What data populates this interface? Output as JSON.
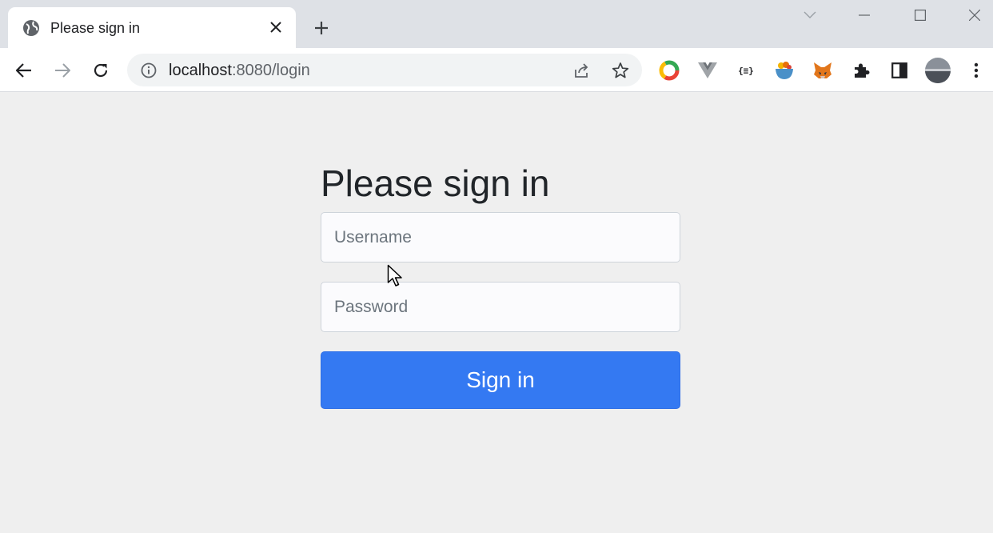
{
  "browser": {
    "tab_title": "Please sign in",
    "url_host": "localhost",
    "url_path": ":8080/login"
  },
  "page": {
    "heading": "Please sign in",
    "username_placeholder": "Username",
    "password_placeholder": "Password",
    "signin_label": "Sign in"
  },
  "colors": {
    "accent": "#3479f2",
    "page_background": "#efefef",
    "tab_strip": "#dee1e6"
  },
  "icons": {
    "favicon": "globe-icon",
    "extensions": [
      "colorful-ring-icon",
      "vue-devtools-icon",
      "json-viewer-icon",
      "bowl-icon",
      "metamask-fox-icon",
      "puzzle-icon",
      "side-panel-icon",
      "profile-avatar",
      "kebab-menu-icon"
    ]
  }
}
